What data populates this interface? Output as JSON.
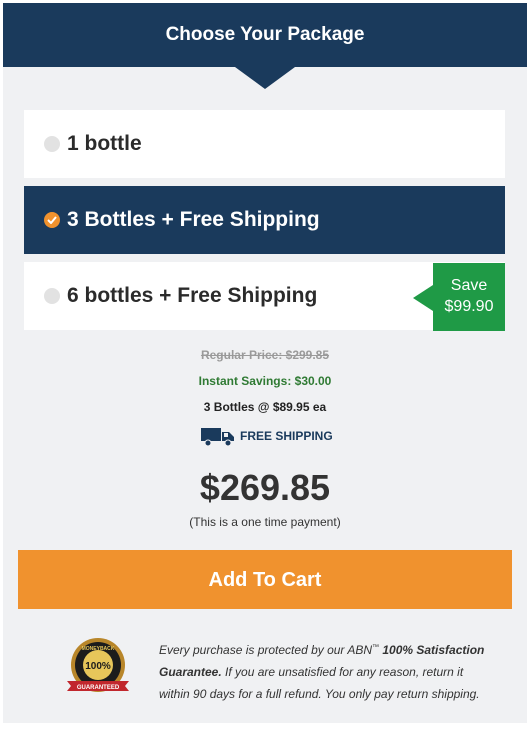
{
  "header": {
    "title": "Choose Your Package"
  },
  "options": [
    {
      "label": "1 bottle",
      "selected": false
    },
    {
      "label": "3 Bottles + Free Shipping",
      "selected": true
    },
    {
      "label": "6 bottles + Free Shipping",
      "selected": false
    }
  ],
  "save_badge": {
    "line1": "Save",
    "line2": "$99.90"
  },
  "summary": {
    "regular_price": "Regular Price: $299.85",
    "instant_savings": "Instant Savings: $30.00",
    "per_bottle": "3 Bottles @ $89.95 ea",
    "free_shipping": "FREE SHIPPING",
    "total": "$269.85",
    "payment_note": "(This is a one time payment)"
  },
  "cart_button": {
    "label": "Add To Cart"
  },
  "seal": {
    "top": "MONEYBACK",
    "center": "100%",
    "ribbon": "GUARANTEED"
  },
  "guarantee": {
    "intro": "Every purchase is protected by our ABN",
    "tm": "™",
    "bold": "100% Satisfaction Guarantee.",
    "rest": " If you are unsatisfied for any reason, return it within 90 days for a full refund. You only pay return shipping."
  },
  "colors": {
    "navy": "#1a3a5c",
    "orange": "#f0922e",
    "green": "#1f9a46",
    "savings_green": "#2f7a33"
  },
  "icons": {
    "shipping": "truck-icon",
    "selected_radio": "check-icon",
    "seal": "money-back-seal-icon"
  }
}
